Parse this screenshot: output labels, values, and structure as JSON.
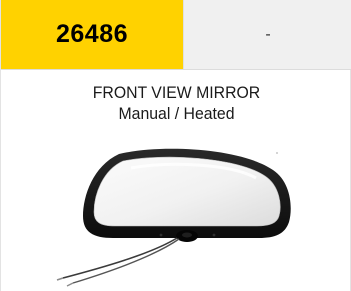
{
  "product": {
    "code": "26486",
    "variant": "-",
    "name": "FRONT VIEW MIRROR",
    "spec": "Manual / Heated",
    "image_icon": "mirror-product-photo"
  },
  "colors": {
    "code_highlight": "#ffd200",
    "variant_background": "#f0f0f0"
  }
}
